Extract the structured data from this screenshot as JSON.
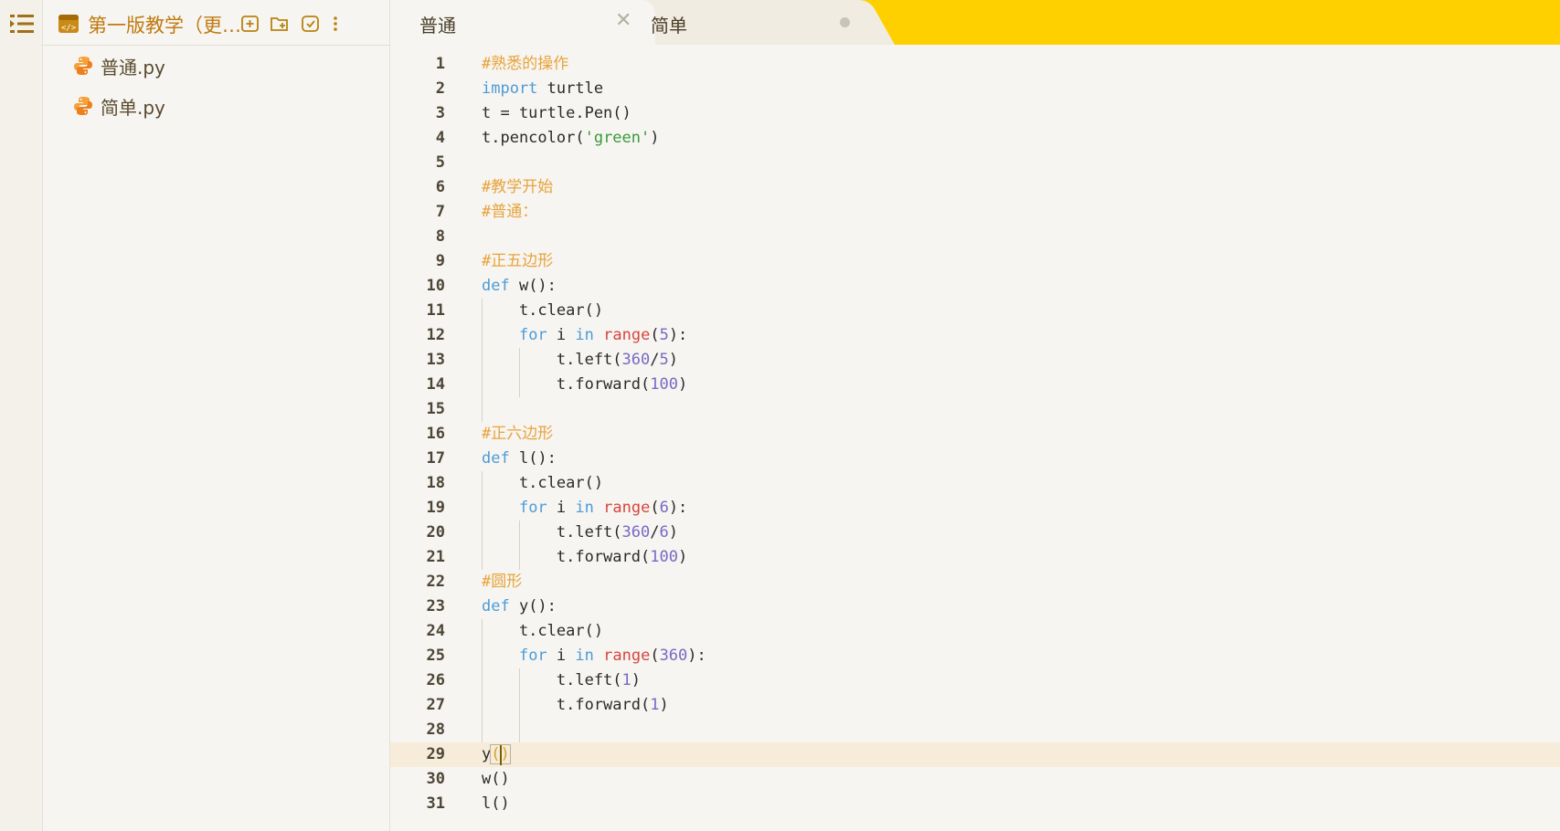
{
  "explorer": {
    "project_title": "第一版教学（更…",
    "files": [
      {
        "name": "普通.py"
      },
      {
        "name": "简单.py"
      }
    ]
  },
  "tabs": [
    {
      "label": "普通",
      "active": true
    },
    {
      "label": "简单",
      "active": false
    }
  ],
  "editor": {
    "current_line": 29,
    "lines": [
      [
        [
          "#熟悉的操作",
          "cm"
        ]
      ],
      [
        [
          "import",
          "kw"
        ],
        [
          " turtle",
          "id"
        ]
      ],
      [
        [
          "t = turtle.Pen()",
          "id"
        ]
      ],
      [
        [
          "t.pencolor(",
          "id"
        ],
        [
          "'green'",
          "str"
        ],
        [
          ")",
          "id"
        ]
      ],
      [],
      [
        [
          "#教学开始",
          "cm"
        ]
      ],
      [
        [
          "#普通：",
          "cm"
        ]
      ],
      [],
      [
        [
          "#正五边形",
          "cm"
        ]
      ],
      [
        [
          "def",
          "kw"
        ],
        [
          " w():",
          "id"
        ]
      ],
      [
        [
          "    t.clear()",
          "id"
        ]
      ],
      [
        [
          "    ",
          "id"
        ],
        [
          "for",
          "kw"
        ],
        [
          " i ",
          "id"
        ],
        [
          "in",
          "kw"
        ],
        [
          " ",
          "id"
        ],
        [
          "range",
          "bi"
        ],
        [
          "(",
          "id"
        ],
        [
          "5",
          "num"
        ],
        [
          "):",
          "id"
        ]
      ],
      [
        [
          "        t.left(",
          "id"
        ],
        [
          "360",
          "num"
        ],
        [
          "/",
          "id"
        ],
        [
          "5",
          "num"
        ],
        [
          ")",
          "id"
        ]
      ],
      [
        [
          "        t.forward(",
          "id"
        ],
        [
          "100",
          "num"
        ],
        [
          ")",
          "id"
        ]
      ],
      [],
      [
        [
          "#正六边形",
          "cm"
        ]
      ],
      [
        [
          "def",
          "kw"
        ],
        [
          " l():",
          "id"
        ]
      ],
      [
        [
          "    t.clear()",
          "id"
        ]
      ],
      [
        [
          "    ",
          "id"
        ],
        [
          "for",
          "kw"
        ],
        [
          " i ",
          "id"
        ],
        [
          "in",
          "kw"
        ],
        [
          " ",
          "id"
        ],
        [
          "range",
          "bi"
        ],
        [
          "(",
          "id"
        ],
        [
          "6",
          "num"
        ],
        [
          "):",
          "id"
        ]
      ],
      [
        [
          "        t.left(",
          "id"
        ],
        [
          "360",
          "num"
        ],
        [
          "/",
          "id"
        ],
        [
          "6",
          "num"
        ],
        [
          ")",
          "id"
        ]
      ],
      [
        [
          "        t.forward(",
          "id"
        ],
        [
          "100",
          "num"
        ],
        [
          ")",
          "id"
        ]
      ],
      [
        [
          "#圆形",
          "cm"
        ]
      ],
      [
        [
          "def",
          "kw"
        ],
        [
          " y():",
          "id"
        ]
      ],
      [
        [
          "    t.clear()",
          "id"
        ]
      ],
      [
        [
          "    ",
          "id"
        ],
        [
          "for",
          "kw"
        ],
        [
          " i ",
          "id"
        ],
        [
          "in",
          "kw"
        ],
        [
          " ",
          "id"
        ],
        [
          "range",
          "bi"
        ],
        [
          "(",
          "id"
        ],
        [
          "360",
          "num"
        ],
        [
          "):",
          "id"
        ]
      ],
      [
        [
          "        t.left(",
          "id"
        ],
        [
          "1",
          "num"
        ],
        [
          ")",
          "id"
        ]
      ],
      [
        [
          "        t.forward(",
          "id"
        ],
        [
          "1",
          "num"
        ],
        [
          ")",
          "id"
        ]
      ],
      [],
      [
        [
          "y",
          "id"
        ],
        [
          "()",
          "br"
        ]
      ],
      [
        [
          "w()",
          "id"
        ]
      ],
      [
        [
          "l()",
          "id"
        ]
      ]
    ]
  },
  "colors": {
    "accent": "#ffd000",
    "comment": "#e8a33b",
    "keyword": "#4d9bd6",
    "builtin": "#d8453f",
    "string": "#3a9a3a",
    "number": "#7a68c4",
    "bracket_match": "#d4a420",
    "text": "#2b2b2b"
  },
  "icons": {
    "menu": "menu-icon",
    "project": "code-file-icon",
    "new_file": "new-file-icon",
    "new_folder": "new-folder-icon",
    "refresh": "refresh-icon",
    "more": "more-vertical-icon",
    "python": "python-icon",
    "close": "close-icon"
  }
}
